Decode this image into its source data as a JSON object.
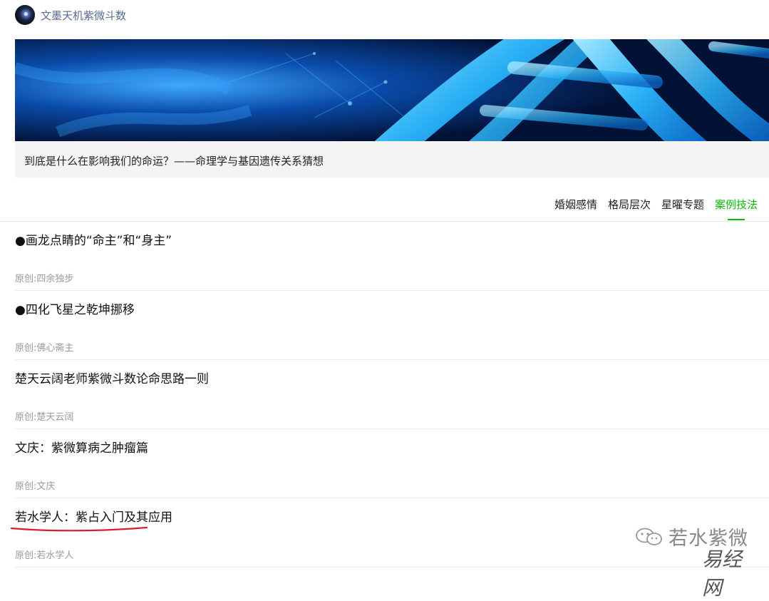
{
  "account": {
    "name": "文墨天机紫微斗数",
    "avatar_icon": "galaxy-avatar-icon"
  },
  "banner": {
    "title": "到底是什么在影响我们的命运？——命理学与基因遗传关系猜想",
    "image": "blue-dna-helix-image"
  },
  "tabs": [
    {
      "label": "婚姻感情"
    },
    {
      "label": "格局层次"
    },
    {
      "label": "星曜专题"
    },
    {
      "label": "案例技法",
      "active": true
    }
  ],
  "articles": [
    {
      "title": "●画龙点睛的“命主”和“身主”",
      "meta": "原创:四余独步"
    },
    {
      "title": "●四化飞星之乾坤挪移",
      "meta": "原创:佛心斋主"
    },
    {
      "title": "楚天云阔老师紫微斗数论命思路一则",
      "meta": "原创:楚天云阔"
    },
    {
      "title": "文庆：紫微算病之肿瘤篇",
      "meta": "原创:文庆"
    },
    {
      "title": "若水学人：紫占入门及其应用",
      "meta": "原创:若水学人"
    }
  ],
  "watermark": {
    "line1": "若水紫微",
    "line2": "易经网",
    "icon": "wechat-icon"
  },
  "colors": {
    "accent": "#09bb07",
    "link": "#576b95",
    "highlight_underline": "#d81e2c"
  }
}
